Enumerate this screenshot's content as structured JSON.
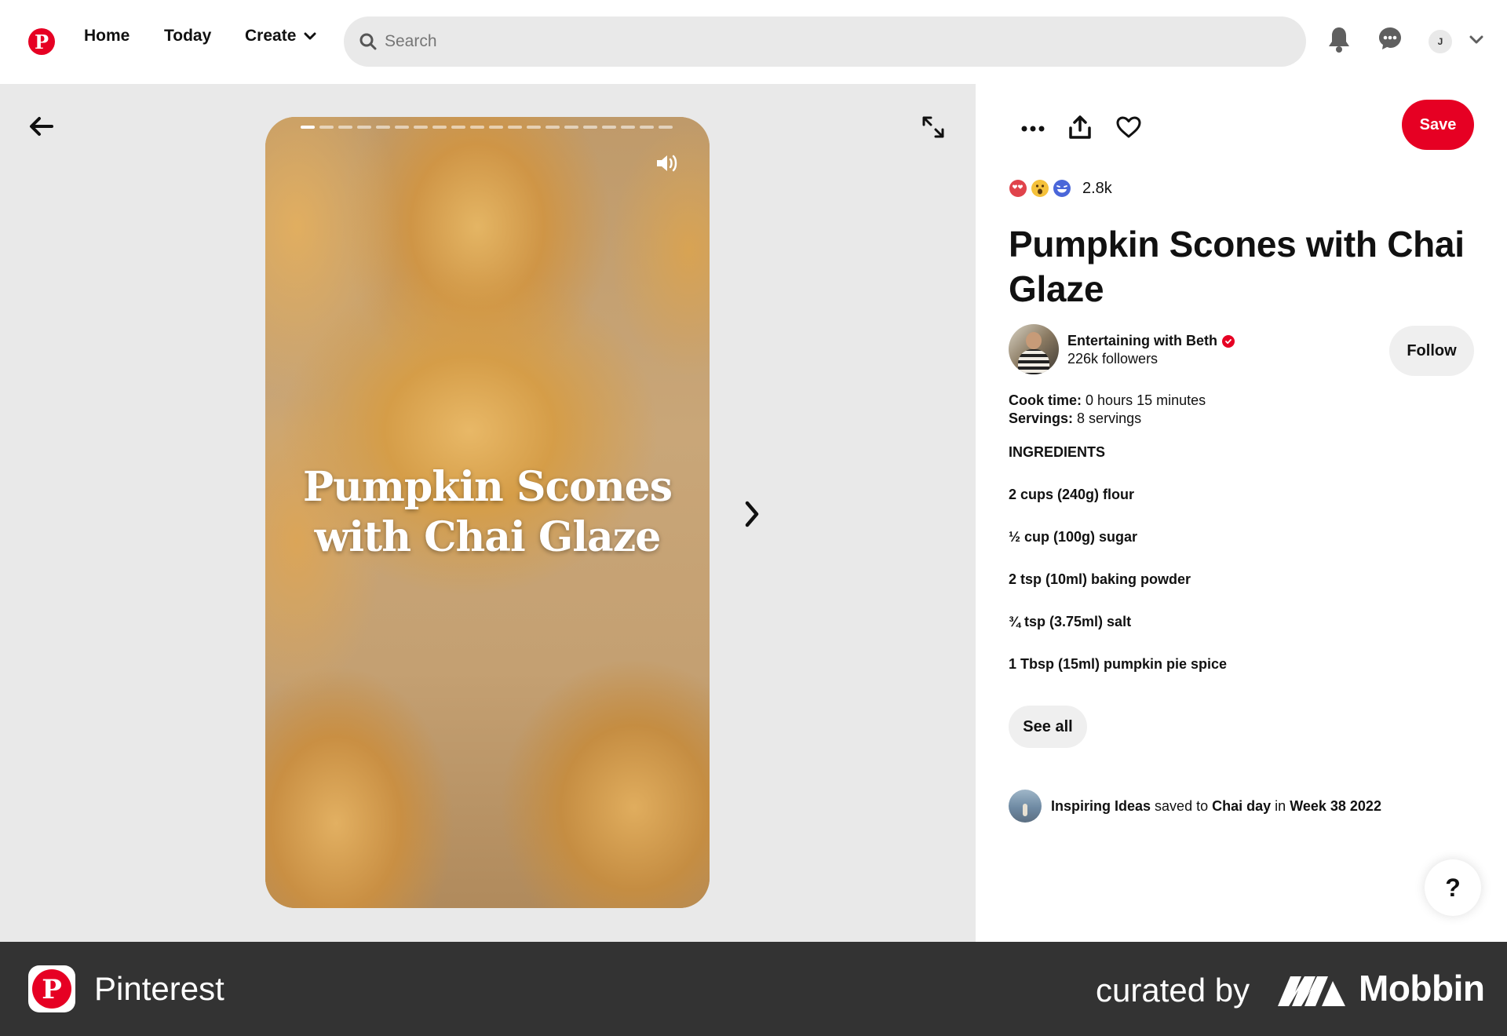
{
  "nav": {
    "home": "Home",
    "today": "Today",
    "create": "Create",
    "search_placeholder": "Search",
    "avatar_initial": "J"
  },
  "story": {
    "title_line1": "Pumpkin Scones",
    "title_line2": "with Chai Glaze",
    "segments_total": 20,
    "current_segment": 1
  },
  "pin": {
    "save_label": "Save",
    "reaction_count": "2.8k",
    "title": "Pumpkin Scones with Chai Glaze",
    "creator_name": "Entertaining with Beth",
    "creator_followers": "226k followers",
    "follow_label": "Follow",
    "cook_time_label": "Cook time:",
    "cook_time_value": "0 hours 15 minutes",
    "servings_label": "Servings:",
    "servings_value": "8 servings",
    "ingredients_heading": "INGREDIENTS",
    "ingredients": [
      "2 cups (240g) flour",
      "½ cup (100g) sugar",
      "2 tsp (10ml) baking powder",
      "¾ tsp (3.75ml) salt",
      "1 Tbsp (15ml) pumpkin pie spice"
    ],
    "see_all_label": "See all",
    "saved_by": "Inspiring Ideas",
    "saved_to_text": "saved to",
    "board": "Chai day",
    "in_text": "in",
    "section": "Week 38 2022"
  },
  "help_label": "?",
  "footer": {
    "app_name": "Pinterest",
    "curated_by": "curated by",
    "brand": "Mobbin"
  },
  "colors": {
    "brand_red": "#e60023",
    "pane_gray": "#e9e9e9",
    "footer_bg": "#333333"
  }
}
